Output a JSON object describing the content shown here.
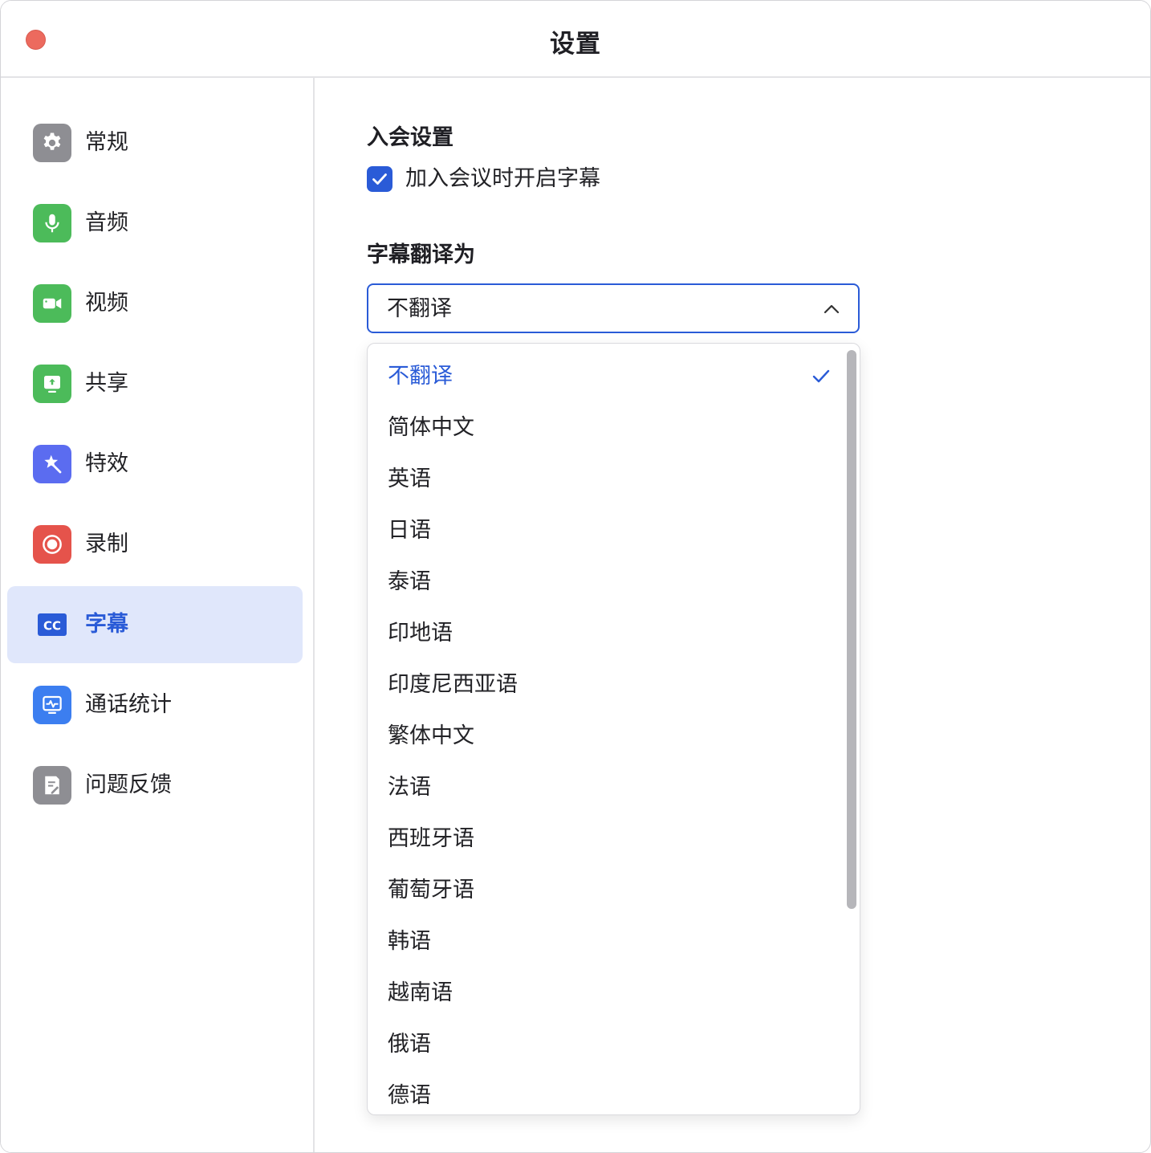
{
  "window": {
    "title": "设置"
  },
  "colors": {
    "accent": "#2a5bd7",
    "close": "#ec6a5e"
  },
  "sidebar": {
    "items": [
      {
        "label": "常规",
        "icon": "gear-icon",
        "color": "#8e8e93"
      },
      {
        "label": "音频",
        "icon": "microphone-icon",
        "color": "#4cbb5a"
      },
      {
        "label": "视频",
        "icon": "video-camera-icon",
        "color": "#4cbb5a"
      },
      {
        "label": "共享",
        "icon": "share-screen-icon",
        "color": "#4cbb5a"
      },
      {
        "label": "特效",
        "icon": "effects-icon",
        "color": "#5b6cf0"
      },
      {
        "label": "录制",
        "icon": "record-icon",
        "color": "#e5534b"
      },
      {
        "label": "字幕",
        "icon": "cc-icon",
        "color": "#2a5bd7",
        "active": true
      },
      {
        "label": "通话统计",
        "icon": "stats-icon",
        "color": "#3c7ef0"
      },
      {
        "label": "问题反馈",
        "icon": "feedback-icon",
        "color": "#8e8e93"
      }
    ]
  },
  "content": {
    "join_section_title": "入会设置",
    "enable_captions_label": "加入会议时开启字幕",
    "translate_section_title": "字幕翻译为",
    "select_value": "不翻译",
    "options": [
      "不翻译",
      "简体中文",
      "英语",
      "日语",
      "泰语",
      "印地语",
      "印度尼西亚语",
      "繁体中文",
      "法语",
      "西班牙语",
      "葡萄牙语",
      "韩语",
      "越南语",
      "俄语",
      "德语"
    ]
  }
}
